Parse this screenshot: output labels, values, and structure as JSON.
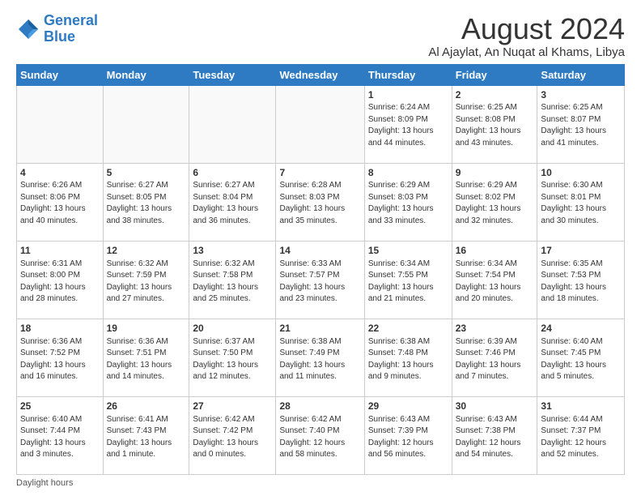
{
  "logo": {
    "line1": "General",
    "line2": "Blue"
  },
  "header": {
    "month_year": "August 2024",
    "location": "Al Ajaylat, An Nuqat al Khams, Libya"
  },
  "days_of_week": [
    "Sunday",
    "Monday",
    "Tuesday",
    "Wednesday",
    "Thursday",
    "Friday",
    "Saturday"
  ],
  "weeks": [
    [
      {
        "day": "",
        "info": ""
      },
      {
        "day": "",
        "info": ""
      },
      {
        "day": "",
        "info": ""
      },
      {
        "day": "",
        "info": ""
      },
      {
        "day": "1",
        "info": "Sunrise: 6:24 AM\nSunset: 8:09 PM\nDaylight: 13 hours\nand 44 minutes."
      },
      {
        "day": "2",
        "info": "Sunrise: 6:25 AM\nSunset: 8:08 PM\nDaylight: 13 hours\nand 43 minutes."
      },
      {
        "day": "3",
        "info": "Sunrise: 6:25 AM\nSunset: 8:07 PM\nDaylight: 13 hours\nand 41 minutes."
      }
    ],
    [
      {
        "day": "4",
        "info": "Sunrise: 6:26 AM\nSunset: 8:06 PM\nDaylight: 13 hours\nand 40 minutes."
      },
      {
        "day": "5",
        "info": "Sunrise: 6:27 AM\nSunset: 8:05 PM\nDaylight: 13 hours\nand 38 minutes."
      },
      {
        "day": "6",
        "info": "Sunrise: 6:27 AM\nSunset: 8:04 PM\nDaylight: 13 hours\nand 36 minutes."
      },
      {
        "day": "7",
        "info": "Sunrise: 6:28 AM\nSunset: 8:03 PM\nDaylight: 13 hours\nand 35 minutes."
      },
      {
        "day": "8",
        "info": "Sunrise: 6:29 AM\nSunset: 8:03 PM\nDaylight: 13 hours\nand 33 minutes."
      },
      {
        "day": "9",
        "info": "Sunrise: 6:29 AM\nSunset: 8:02 PM\nDaylight: 13 hours\nand 32 minutes."
      },
      {
        "day": "10",
        "info": "Sunrise: 6:30 AM\nSunset: 8:01 PM\nDaylight: 13 hours\nand 30 minutes."
      }
    ],
    [
      {
        "day": "11",
        "info": "Sunrise: 6:31 AM\nSunset: 8:00 PM\nDaylight: 13 hours\nand 28 minutes."
      },
      {
        "day": "12",
        "info": "Sunrise: 6:32 AM\nSunset: 7:59 PM\nDaylight: 13 hours\nand 27 minutes."
      },
      {
        "day": "13",
        "info": "Sunrise: 6:32 AM\nSunset: 7:58 PM\nDaylight: 13 hours\nand 25 minutes."
      },
      {
        "day": "14",
        "info": "Sunrise: 6:33 AM\nSunset: 7:57 PM\nDaylight: 13 hours\nand 23 minutes."
      },
      {
        "day": "15",
        "info": "Sunrise: 6:34 AM\nSunset: 7:55 PM\nDaylight: 13 hours\nand 21 minutes."
      },
      {
        "day": "16",
        "info": "Sunrise: 6:34 AM\nSunset: 7:54 PM\nDaylight: 13 hours\nand 20 minutes."
      },
      {
        "day": "17",
        "info": "Sunrise: 6:35 AM\nSunset: 7:53 PM\nDaylight: 13 hours\nand 18 minutes."
      }
    ],
    [
      {
        "day": "18",
        "info": "Sunrise: 6:36 AM\nSunset: 7:52 PM\nDaylight: 13 hours\nand 16 minutes."
      },
      {
        "day": "19",
        "info": "Sunrise: 6:36 AM\nSunset: 7:51 PM\nDaylight: 13 hours\nand 14 minutes."
      },
      {
        "day": "20",
        "info": "Sunrise: 6:37 AM\nSunset: 7:50 PM\nDaylight: 13 hours\nand 12 minutes."
      },
      {
        "day": "21",
        "info": "Sunrise: 6:38 AM\nSunset: 7:49 PM\nDaylight: 13 hours\nand 11 minutes."
      },
      {
        "day": "22",
        "info": "Sunrise: 6:38 AM\nSunset: 7:48 PM\nDaylight: 13 hours\nand 9 minutes."
      },
      {
        "day": "23",
        "info": "Sunrise: 6:39 AM\nSunset: 7:46 PM\nDaylight: 13 hours\nand 7 minutes."
      },
      {
        "day": "24",
        "info": "Sunrise: 6:40 AM\nSunset: 7:45 PM\nDaylight: 13 hours\nand 5 minutes."
      }
    ],
    [
      {
        "day": "25",
        "info": "Sunrise: 6:40 AM\nSunset: 7:44 PM\nDaylight: 13 hours\nand 3 minutes."
      },
      {
        "day": "26",
        "info": "Sunrise: 6:41 AM\nSunset: 7:43 PM\nDaylight: 13 hours\nand 1 minute."
      },
      {
        "day": "27",
        "info": "Sunrise: 6:42 AM\nSunset: 7:42 PM\nDaylight: 13 hours\nand 0 minutes."
      },
      {
        "day": "28",
        "info": "Sunrise: 6:42 AM\nSunset: 7:40 PM\nDaylight: 12 hours\nand 58 minutes."
      },
      {
        "day": "29",
        "info": "Sunrise: 6:43 AM\nSunset: 7:39 PM\nDaylight: 12 hours\nand 56 minutes."
      },
      {
        "day": "30",
        "info": "Sunrise: 6:43 AM\nSunset: 7:38 PM\nDaylight: 12 hours\nand 54 minutes."
      },
      {
        "day": "31",
        "info": "Sunrise: 6:44 AM\nSunset: 7:37 PM\nDaylight: 12 hours\nand 52 minutes."
      }
    ]
  ],
  "footer": {
    "daylight_label": "Daylight hours"
  }
}
